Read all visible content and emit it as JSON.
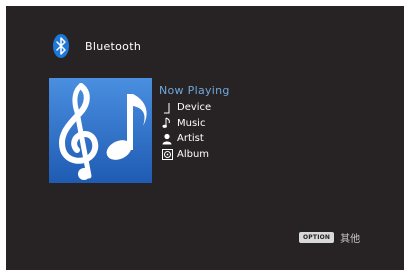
{
  "header": {
    "icon": "bluetooth-icon",
    "title": "Bluetooth"
  },
  "album_art": {
    "icon": "music-notes-icon",
    "background": "#2d6fc4"
  },
  "now_playing": {
    "heading": "Now Playing",
    "items": [
      {
        "icon": "device-icon",
        "label": "Device"
      },
      {
        "icon": "music-note-icon",
        "label": "Music"
      },
      {
        "icon": "artist-icon",
        "label": "Artist"
      },
      {
        "icon": "album-icon",
        "label": "Album"
      }
    ]
  },
  "footer": {
    "option_button": "OPTION",
    "option_label": "其他"
  },
  "colors": {
    "background": "#272324",
    "accent": "#6fa8dc",
    "bluetooth": "#1e78d7"
  }
}
